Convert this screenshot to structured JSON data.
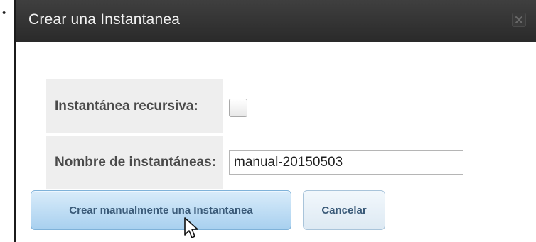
{
  "dialog": {
    "title": "Crear una Instantanea",
    "close_icon": "close-icon"
  },
  "form": {
    "recursive_label": "Instantánea recursiva:",
    "recursive_checked": false,
    "name_label": "Nombre de instantáneas:",
    "name_value": "manual-20150503"
  },
  "buttons": {
    "create_label": "Crear manualmente una Instantanea",
    "cancel_label": "Cancelar"
  },
  "page": {
    "bullet": "•"
  },
  "icons": {
    "cursor": "mouse-pointer-icon"
  },
  "colors": {
    "titlebar": "#333333",
    "button_primary": "#b7d9f3",
    "label_text": "#4a4a4a"
  }
}
